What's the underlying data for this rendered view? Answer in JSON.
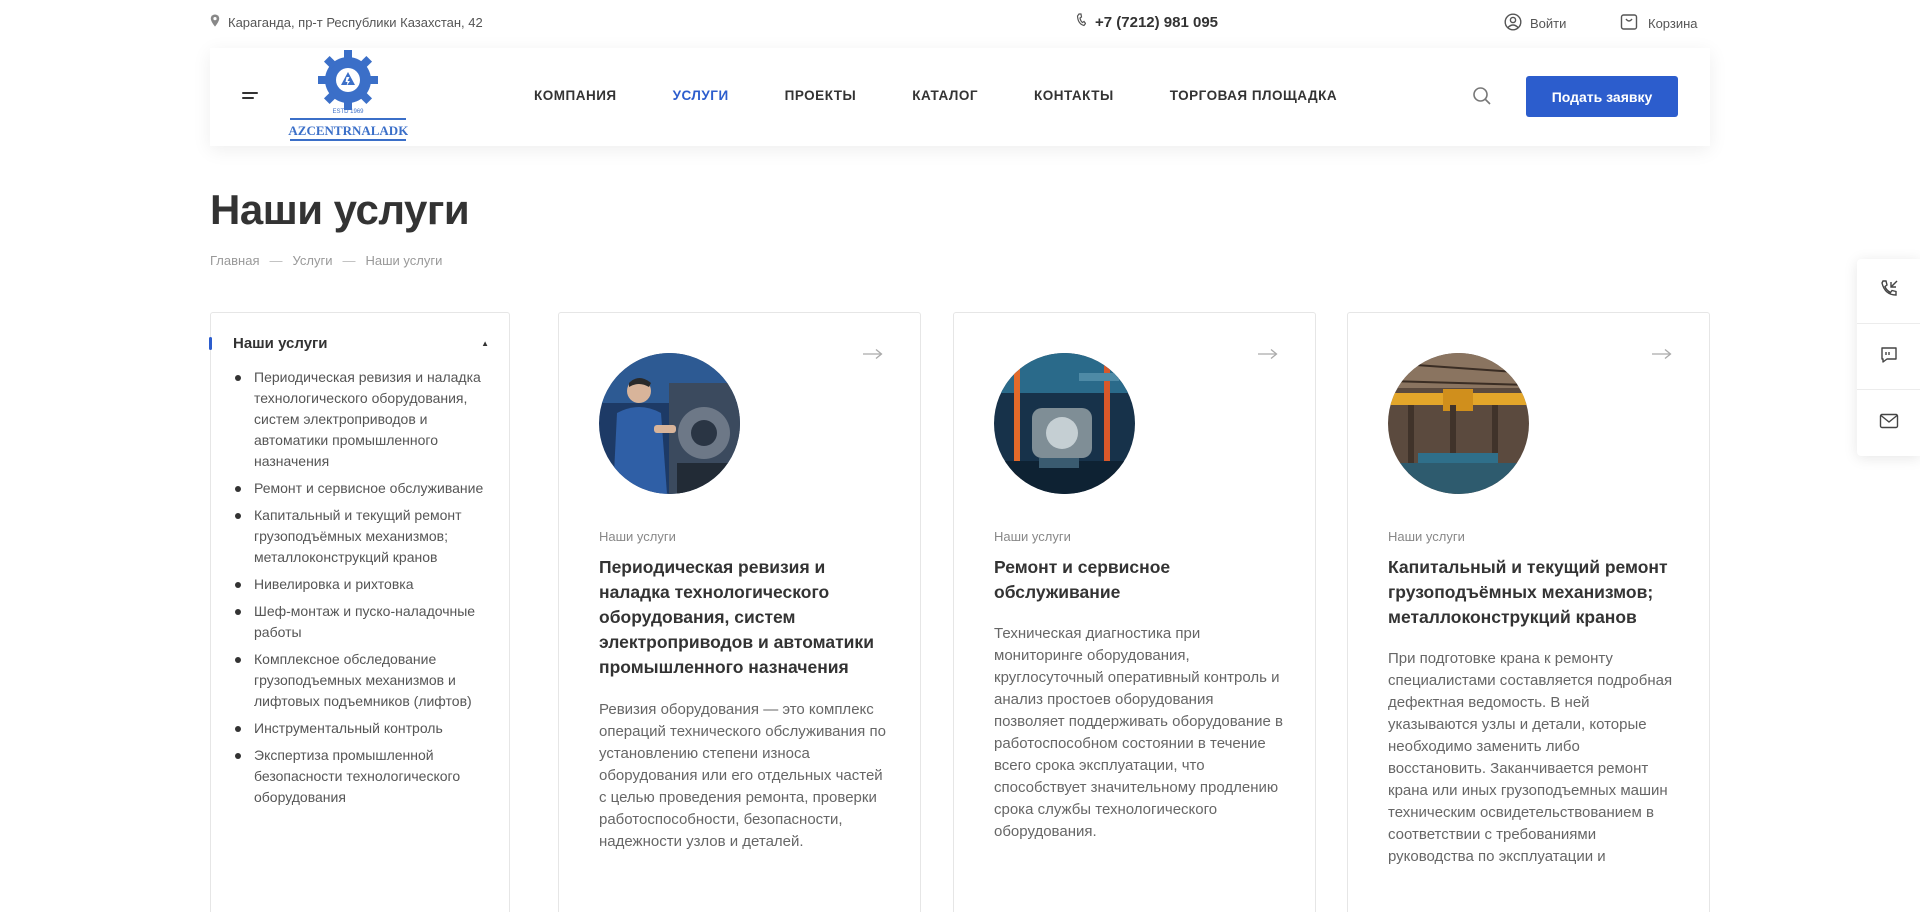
{
  "topbar": {
    "address": "Караганда, пр-т Республики Казахстан, 42",
    "phone": "+7 (7212) 981 095",
    "login": "Войти",
    "cart": "Корзина"
  },
  "header": {
    "logo_text": "KAZCENTRNALADKA",
    "logo_est": "ESTD 1969",
    "nav": [
      {
        "label": "КОМПАНИЯ"
      },
      {
        "label": "УСЛУГИ",
        "active": true
      },
      {
        "label": "ПРОЕКТЫ"
      },
      {
        "label": "КАТАЛОГ"
      },
      {
        "label": "КОНТАКТЫ"
      },
      {
        "label": "ТОРГОВАЯ ПЛОЩАДКА"
      }
    ],
    "cta": "Подать заявку"
  },
  "page": {
    "title": "Наши услуги",
    "breadcrumbs": [
      "Главная",
      "Услуги",
      "Наши услуги"
    ],
    "breadcrumb_sep": "—"
  },
  "sidebar": {
    "title": "Наши услуги",
    "items": [
      "Периодическая ревизия и наладка технологического оборудования, систем электроприводов и автоматики промышленного назначения",
      "Ремонт и сервисное обслуживание",
      "Капитальный и текущий ремонт грузоподъёмных механизмов; металлоконструкций кранов",
      "Нивелировка и рихтовка",
      "Шеф-монтаж и пуско-наладочные работы",
      "Комплексное обследование грузоподъемных механизмов и лифтовых подъемников (лифтов)",
      "Инструментальный контроль",
      "Экспертиза промышленной безопасности технологического оборудования"
    ]
  },
  "cards": [
    {
      "category": "Наши услуги",
      "title": "Периодическая ревизия и наладка технологического оборудования, систем электроприводов и автоматики промышленного назначения",
      "description": "Ревизия оборудования — это комплекс операций технического обслуживания по установлению степени износа оборудования или его отдельных частей с целью проведения ремонта, проверки работоспособности, безопасности, надежности узлов и деталей."
    },
    {
      "category": "Наши услуги",
      "title": "Ремонт и сервисное обслуживание",
      "description": "Техническая диагностика при мониторинге оборудования, круглосуточный оперативный контроль и анализ простоев оборудования позволяет поддерживать оборудование в работоспособном состоянии в течение всего срока эксплуатации, что способствует значительному продлению срока службы технологического оборудования."
    },
    {
      "category": "Наши услуги",
      "title": "Капитальный и текущий ремонт грузоподъёмных механизмов; металлоконструкций кранов",
      "description": "При подготовке крана к ремонту специалистами составляется подробная дефектная ведомость. В ней указываются узлы и детали, которые необходимо заменить либо восстановить. Заканчивается ремонт крана или иных грузоподъемных машин техническим освидетельствованием в соответствии с требованиями руководства по эксплуатации и"
    }
  ],
  "colors": {
    "accent": "#2c5dcd",
    "text": "#333333",
    "muted": "#888888"
  }
}
